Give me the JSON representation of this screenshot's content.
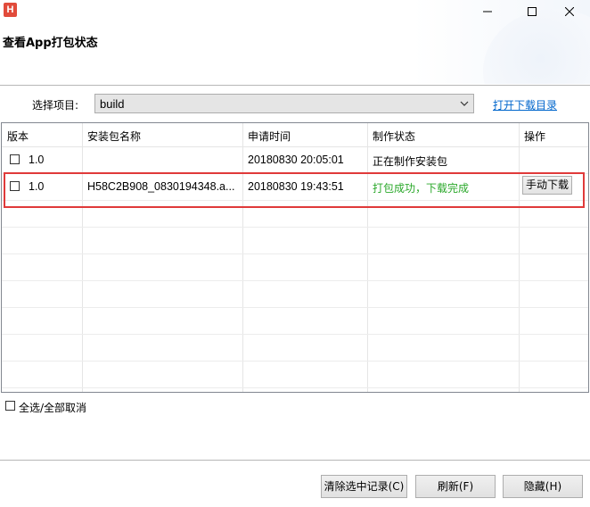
{
  "window": {
    "app_icon_letter": "H",
    "title": "查看App打包状态"
  },
  "project": {
    "label": "选择项目:",
    "selected": "build",
    "open_link": "打开下载目录"
  },
  "table": {
    "columns": [
      "版本",
      "安装包名称",
      "申请时间",
      "制作状态",
      "操作"
    ],
    "rows": [
      {
        "version": "1.0",
        "package": "",
        "time": "20180830 20:05:01",
        "status": "正在制作安装包",
        "action": ""
      },
      {
        "version": "1.0",
        "package": "H58C2B908_0830194348.a...",
        "time": "20180830 19:43:51",
        "status": "打包成功，下载完成",
        "action": "手动下载"
      }
    ]
  },
  "select_all_label": "全选/全部取消",
  "buttons": {
    "clear": "清除选中记录(C)",
    "refresh": "刷新(F)",
    "hide": "隐藏(H)"
  },
  "colors": {
    "success_text": "#2aa82a",
    "link": "#0066cc",
    "highlight_box": "#e03a3a"
  }
}
